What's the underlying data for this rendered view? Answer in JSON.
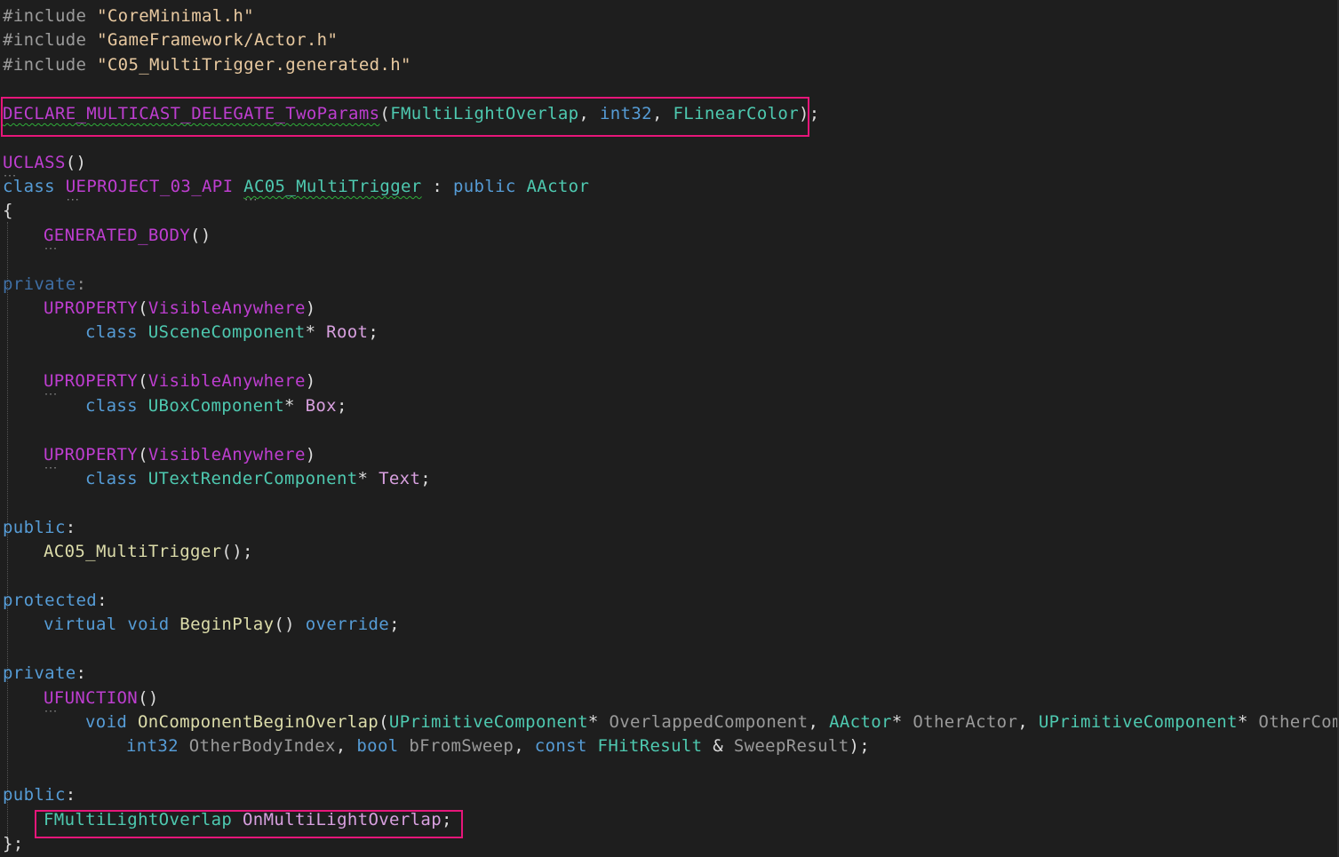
{
  "code": {
    "include1_kw": "#include",
    "include1_file": "\"CoreMinimal.h\"",
    "include2_kw": "#include",
    "include2_file": "\"GameFramework/Actor.h\"",
    "include3_kw": "#include",
    "include3_file": "\"C05_MultiTrigger.generated.h\"",
    "delegate_macro": "DECLARE_MULTICAST_DELEGATE_TwoParams",
    "delegate_name": "FMultiLightOverlap",
    "delegate_p1": "int32",
    "delegate_p2": "FLinearColor",
    "uclass": "UCLASS",
    "class_kw": "class",
    "api_macro": "UEPROJECT_03_API",
    "class_name": "AC05_MultiTrigger",
    "public_kw": "public",
    "base_class": "AActor",
    "open_brace": "{",
    "generated_body": "GENERATED_BODY",
    "private_label_1": "private",
    "uproperty": "UPROPERTY",
    "visible_anywhere": "VisibleAnywhere",
    "root_type": "USceneComponent",
    "root_name": "Root",
    "box_type": "UBoxComponent",
    "box_name": "Box",
    "text_type": "UTextRenderComponent",
    "text_name": "Text",
    "public_label_1": "public",
    "ctor_name": "AC05_MultiTrigger",
    "protected_label": "protected",
    "virtual_kw": "virtual",
    "void_kw": "void",
    "begin_play": "BeginPlay",
    "override_kw": "override",
    "private_label_2": "private",
    "ufunction": "UFUNCTION",
    "overlap_fn": "OnComponentBeginOverlap",
    "prim_type": "UPrimitiveComponent",
    "overlapped_component": "OverlappedComponent",
    "actor_type": "AActor",
    "other_actor": "OtherActor",
    "other_comp": "OtherComp",
    "int32_kw": "int32",
    "other_body_index": "OtherBodyIndex",
    "bool_kw": "bool",
    "from_sweep": "bFromSweep",
    "const_kw": "const",
    "hit_result": "FHitResult",
    "sweep_result": "SweepResult",
    "public_label_2": "public",
    "event_type": "FMultiLightOverlap",
    "event_name": "OnMultiLightOverlap",
    "close_brace": "};"
  },
  "colors": {
    "background": "#1e1e1e",
    "highlight": "#e6167a",
    "macro": "#be3ed0",
    "keyword": "#569cd6",
    "type": "#4ec9b0",
    "function": "#dcdcaa",
    "string": "#e8c9a0"
  }
}
